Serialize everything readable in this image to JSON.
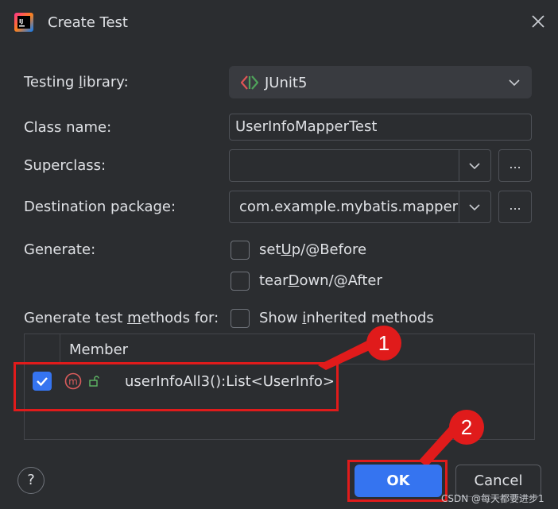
{
  "window": {
    "title": "Create Test",
    "app_icon": "intellij-idea-icon",
    "close_icon": "close-icon"
  },
  "form": {
    "testing_library": {
      "label_pre": "Testing ",
      "label_mn": "l",
      "label_post": "ibrary:",
      "value": "JUnit5",
      "icon": "junit5-icon"
    },
    "class_name": {
      "label": "Class name:",
      "value": "UserInfoMapperTest"
    },
    "superclass": {
      "label": "Superclass:",
      "value": "",
      "browse": "..."
    },
    "destination_package": {
      "label": "Destination package:",
      "value": "com.example.mybatis.mapper",
      "browse": "..."
    },
    "generate": {
      "label": "Generate:",
      "setup": {
        "pre": "set",
        "mn": "U",
        "post": "p/@Before",
        "checked": false
      },
      "teardown": {
        "pre": "tear",
        "mn": "D",
        "post": "own/@After",
        "checked": false
      }
    },
    "methods": {
      "label_pre": "Generate test ",
      "label_mn": "m",
      "label_post": "ethods for:",
      "show_inherited": {
        "pre": "Show ",
        "mn": "i",
        "post": "nherited methods",
        "checked": false
      }
    }
  },
  "table": {
    "columns": [
      "Member"
    ],
    "rows": [
      {
        "checked": true,
        "method": "userInfoAll3():List<UserInfo>",
        "icon": "method-icon",
        "visibility_icon": "public-lock-icon"
      }
    ]
  },
  "annotations": {
    "badge1": "1",
    "badge2": "2",
    "color": "#e01b1b"
  },
  "buttons": {
    "help": "?",
    "ok": "OK",
    "cancel": "Cancel"
  },
  "watermark": "CSDN @每天都要进步1",
  "colors": {
    "background": "#2b2d30",
    "accent": "#3574f0",
    "annotation": "#e01b1b"
  }
}
